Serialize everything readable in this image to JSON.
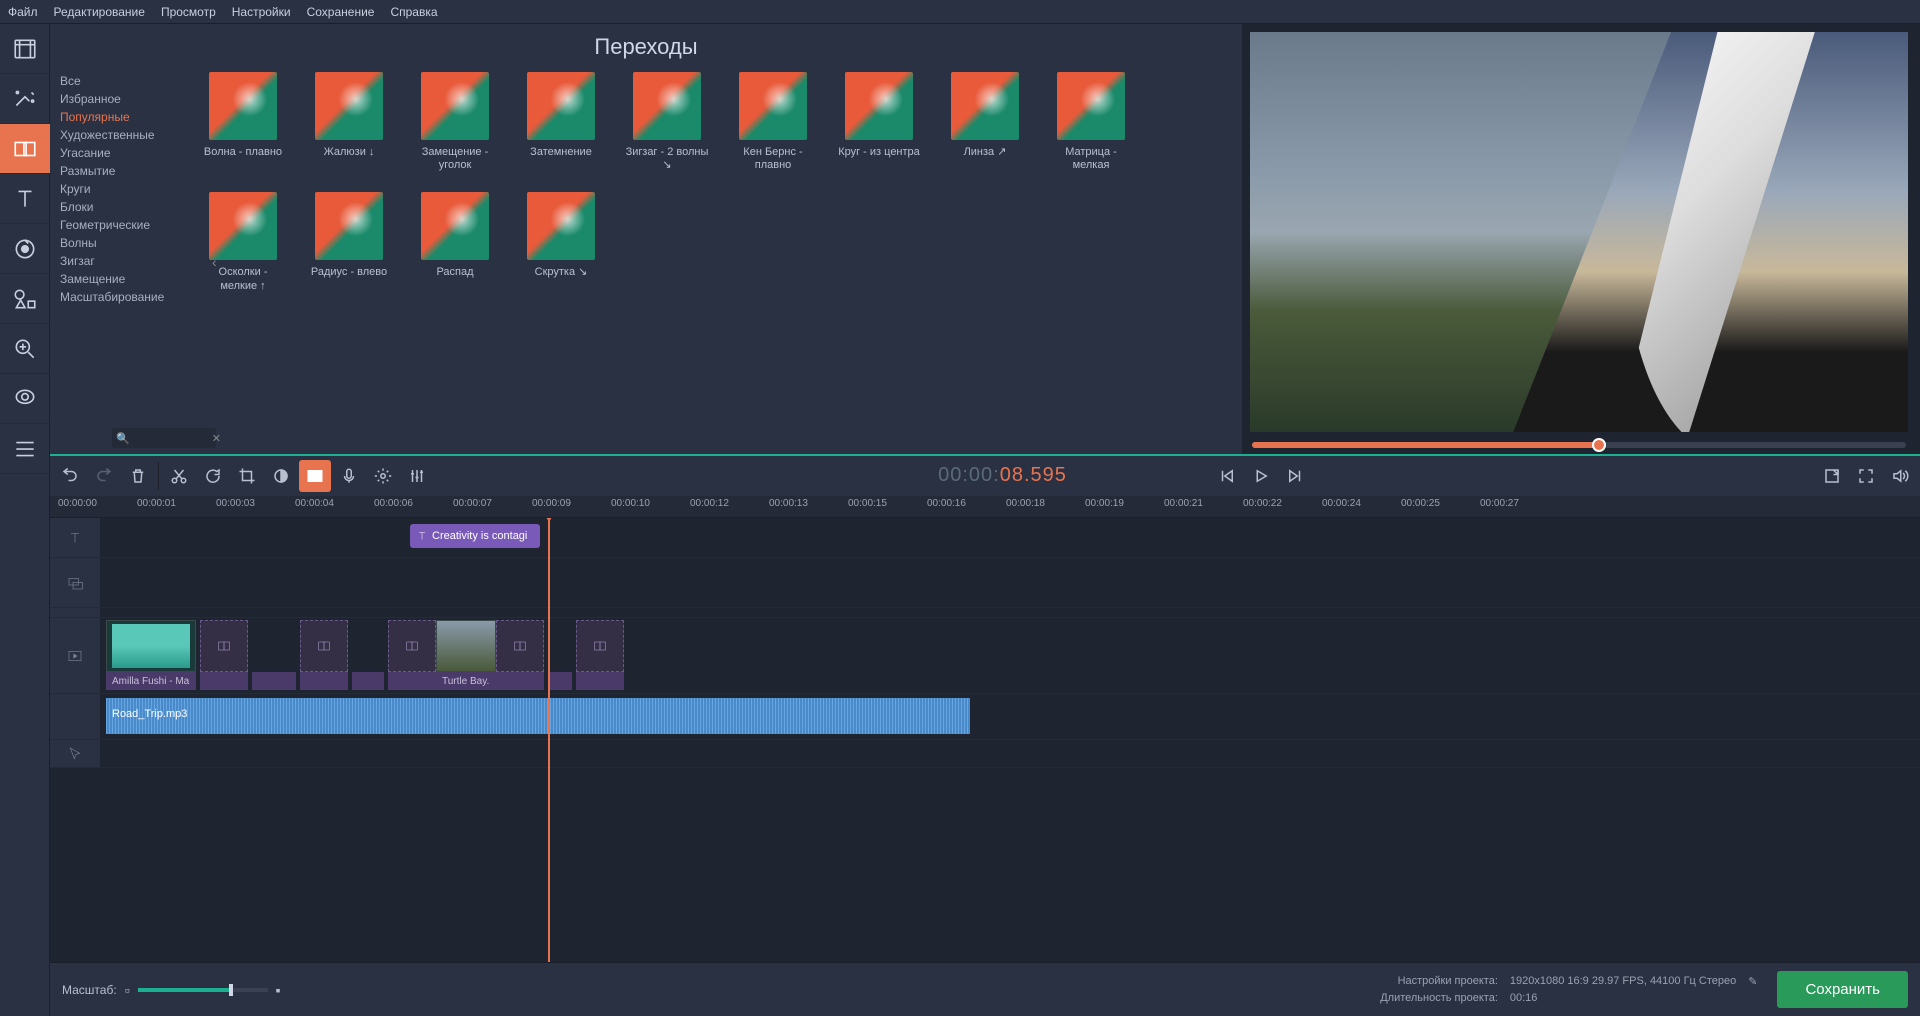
{
  "menubar": [
    "Файл",
    "Редактирование",
    "Просмотр",
    "Настройки",
    "Сохранение",
    "Справка"
  ],
  "panel": {
    "title": "Переходы"
  },
  "categories": [
    "Все",
    "Избранное",
    "Популярные",
    "Художественные",
    "Угасание",
    "Размытие",
    "Круги",
    "Блоки",
    "Геометрические",
    "Волны",
    "Зигзаг",
    "Замещение",
    "Масштабирование"
  ],
  "selectedCategory": 2,
  "transitions": [
    {
      "label": "Волна - плавно"
    },
    {
      "label": "Жалюзи ↓"
    },
    {
      "label": "Замещение - уголок"
    },
    {
      "label": "Затемнение"
    },
    {
      "label": "Зигзаг - 2 волны ↘"
    },
    {
      "label": "Кен Бернс - плавно"
    },
    {
      "label": "Круг - из центра"
    },
    {
      "label": "Линза ↗"
    },
    {
      "label": "Матрица - мелкая"
    },
    {
      "label": "Осколки - мелкие ↑"
    },
    {
      "label": "Радиус - влево"
    },
    {
      "label": "Распад"
    },
    {
      "label": "Скрутка ↘"
    }
  ],
  "timecode": {
    "prefix": "00:00:",
    "highlight": "08.595"
  },
  "ruler": [
    "00:00:00",
    "00:00:01",
    "00:00:03",
    "00:00:04",
    "00:00:06",
    "00:00:07",
    "00:00:09",
    "00:00:10",
    "00:00:12",
    "00:00:13",
    "00:00:15",
    "00:00:16",
    "00:00:18",
    "00:00:19",
    "00:00:21",
    "00:00:22",
    "00:00:24",
    "00:00:25",
    "00:00:27"
  ],
  "titleClip": {
    "text": "Creativity is contagi"
  },
  "videoClips": [
    {
      "label": "Amilla Fushi - Ma"
    },
    {
      "label": "Turtle Bay."
    }
  ],
  "audioClip": {
    "label": "Road_Trip.mp3"
  },
  "status": {
    "zoomLabel": "Масштаб:",
    "settingsLabel": "Настройки проекта:",
    "settingsValue": "1920x1080 16:9 29.97 FPS, 44100 Гц Стерео",
    "durationLabel": "Длительность проекта:",
    "durationValue": "00:16",
    "saveLabel": "Сохранить"
  }
}
